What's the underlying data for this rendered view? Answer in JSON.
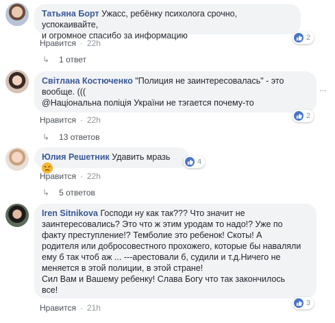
{
  "comments": [
    {
      "author": "Татьяна Борт",
      "text_lines": [
        "Ужасс, ребёнку психолога срочно, успокаивайте,",
        "и огромное спасибо за информацию"
      ],
      "reaction_count": "2",
      "like_label": "Нравится",
      "time": "22h",
      "replies_label": "1 ответ"
    },
    {
      "author": "Світлана Костюченко",
      "text_lines": [
        "\"Полиция не заинтересовалась\" - это",
        "вообще. (((",
        "@Національна поліція України не тэгается почему-то"
      ],
      "reaction_count": "2",
      "like_label": "Нравится",
      "time": "22h",
      "replies_label": "13 ответов"
    },
    {
      "author": "Юлия Решетник",
      "text_lines": [
        "Удавить мразь"
      ],
      "reaction_count": "4",
      "like_label": "Нравится",
      "time": "22h",
      "replies_label": "5 ответов"
    },
    {
      "author": "Iren Sitnikova",
      "text_lines": [
        "Господи ну как так??? Что значит не",
        "заинтересовались? Это что ж этим уродам то надо!? Уже по",
        "факту преступление!? Темболие это ребенок! Скоты! А",
        "родителя или добросовестного прохожего, которые бы наваляли",
        "ему б так чтоб аж ... ---арестовали б, судили и т.д.Ничего не",
        "меняется в этой полиции, в этой стране!",
        "Сил Вам и Вашему ребенку! Слава Богу что так закончилось",
        "все!"
      ],
      "reaction_count": "3",
      "like_label": "Нравится",
      "time": "21h"
    }
  ],
  "colors": {
    "author": "#385898",
    "bubble_bg": "#f2f3f5",
    "meta": "#90949c",
    "like_blue": "#4a76c8"
  },
  "icons": {
    "reaction": "like-thumb-icon",
    "reply_arrow": "reply-arrow-icon",
    "more": "more-options-icon",
    "emoji": "angry-face-emoji"
  }
}
